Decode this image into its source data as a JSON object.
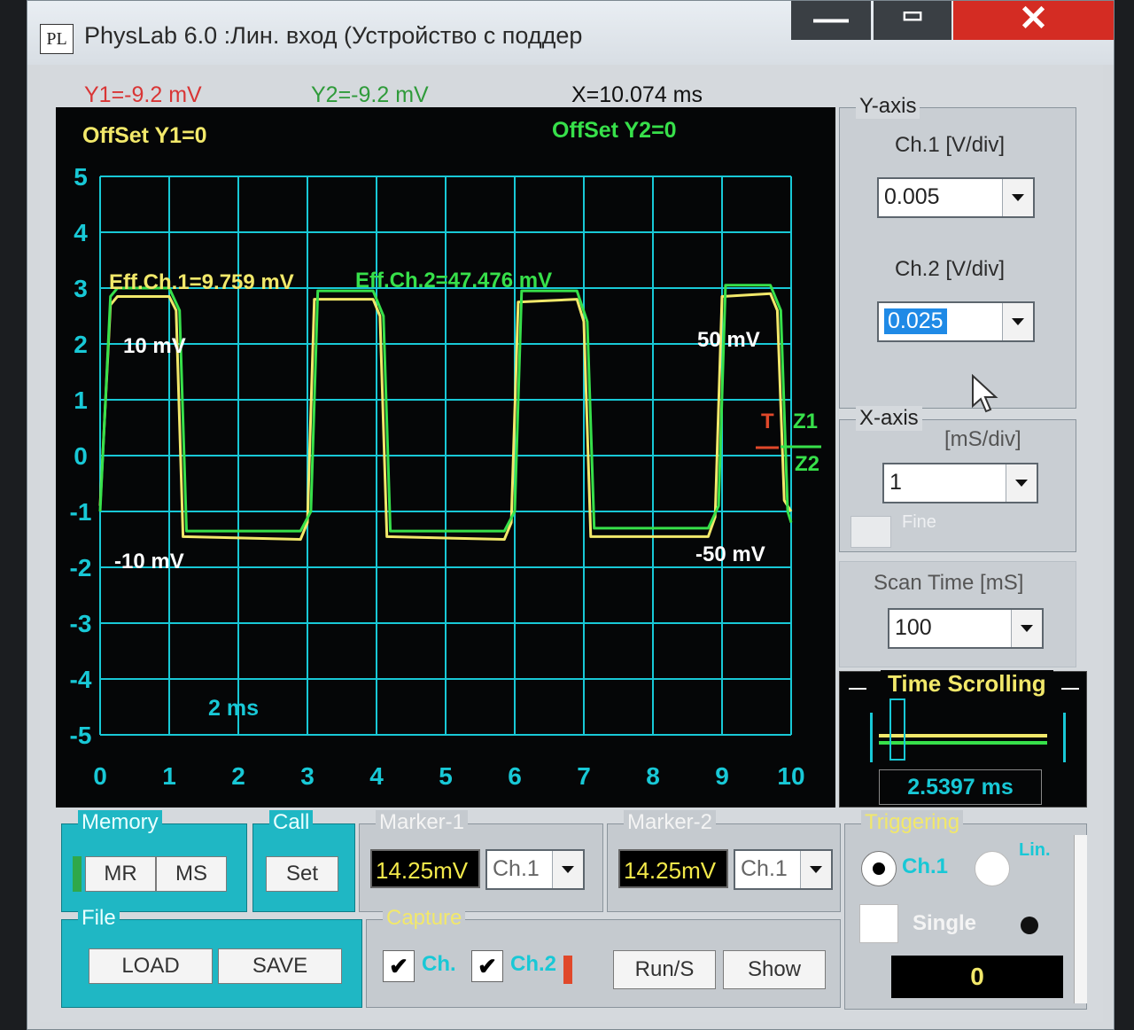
{
  "window": {
    "title": "PhysLab 6.0 :Лин. вход (Устройство с поддер",
    "logo_text": "PL",
    "minimize_glyph": "—",
    "maximize_glyph": "▭",
    "close_glyph": "✕"
  },
  "readouts": {
    "y1": "Y1=-9.2 mV",
    "y2": "Y2=-9.2 mV",
    "x": "X=10.074 ms"
  },
  "scope": {
    "offset_y1": "OffSet Y1=0",
    "offset_y2": "OffSet Y2=0",
    "eff_ch1": "Eff.Ch.1=9.759 mV",
    "eff_ch2": "Eff.Ch.2=47.476 mV",
    "ch1_top_label": "10 mV",
    "ch1_bottom_label": "-10 mV",
    "ch2_top_label": "50 mV",
    "ch2_bottom_label": "-50 mV",
    "time_label": "2 ms",
    "trigger_label": "T",
    "z1_label": "Z1",
    "z2_label": "Z2",
    "colors": {
      "grid": "#18c8d6",
      "ch1": "#f2e86a",
      "ch2": "#37e04a",
      "trigger": "#e0482a",
      "background": "#050607"
    }
  },
  "chart_data": {
    "type": "line",
    "xlim": [
      0,
      10
    ],
    "ylim": [
      -5,
      5
    ],
    "x_ticks": [
      "0",
      "1",
      "2",
      "3",
      "4",
      "5",
      "6",
      "7",
      "8",
      "9",
      "10"
    ],
    "y_ticks": [
      "5",
      "4",
      "3",
      "2",
      "1",
      "0",
      "-1",
      "-2",
      "-3",
      "-4",
      "-5"
    ],
    "grid": true,
    "series": [
      {
        "name": "Eff.Ch.1=9.759 mV",
        "x": [
          0,
          0.15,
          0.25,
          1.0,
          1.1,
          1.2,
          2.9,
          3.0,
          3.1,
          3.95,
          4.05,
          4.15,
          5.85,
          5.95,
          6.05,
          6.9,
          7.0,
          7.1,
          8.8,
          8.9,
          9.0,
          9.7,
          9.8,
          9.9,
          10.0
        ],
        "y": [
          -0.9,
          2.7,
          2.85,
          2.85,
          2.6,
          -1.45,
          -1.5,
          -1.2,
          2.8,
          2.8,
          2.5,
          -1.45,
          -1.5,
          -1.2,
          2.75,
          2.8,
          2.4,
          -1.45,
          -1.45,
          -1.1,
          2.85,
          2.9,
          2.6,
          -0.8,
          -1.0
        ]
      },
      {
        "name": "Eff.Ch.2=47.476 mV",
        "x": [
          0,
          0.15,
          0.25,
          1.0,
          1.15,
          1.25,
          2.9,
          3.05,
          3.15,
          3.95,
          4.1,
          4.2,
          5.85,
          6.0,
          6.1,
          6.9,
          7.05,
          7.15,
          8.8,
          8.95,
          9.05,
          9.7,
          9.85,
          9.95,
          10.0
        ],
        "y": [
          -1.0,
          2.85,
          3.0,
          3.0,
          2.6,
          -1.35,
          -1.35,
          -1.0,
          2.95,
          2.95,
          2.5,
          -1.35,
          -1.35,
          -1.0,
          2.95,
          2.95,
          2.4,
          -1.3,
          -1.3,
          -0.9,
          3.05,
          3.05,
          2.6,
          -1.0,
          -1.2
        ]
      }
    ]
  },
  "y_axis": {
    "legend": "Y-axis",
    "ch1_label": "Ch.1 [V/div]",
    "ch1_value": "0.005",
    "ch2_label": "Ch.2 [V/div]",
    "ch2_value": "0.025"
  },
  "x_axis": {
    "legend": "X-axis",
    "unit_label": "[mS/div]",
    "value": "1",
    "fine_label": "Fine"
  },
  "scan_time": {
    "label": "Scan Time [mS]",
    "value": "100"
  },
  "time_scrolling": {
    "legend": "Time Scrolling",
    "value": "2.5397 ms"
  },
  "memory": {
    "legend": "Memory",
    "mr_label": "MR",
    "ms_label": "MS"
  },
  "call": {
    "legend": "Call",
    "set_label": "Set"
  },
  "marker1": {
    "legend": "Marker-1",
    "value": "14.25mV",
    "channel": "Ch.1"
  },
  "marker2": {
    "legend": "Marker-2",
    "value": "14.25mV",
    "channel": "Ch.1"
  },
  "triggering": {
    "legend": "Triggering",
    "ch1_label": "Ch.1",
    "lin_label": "Lin.",
    "single_label": "Single",
    "count": "0"
  },
  "file": {
    "legend": "File",
    "load_label": "LOAD",
    "save_label": "SAVE"
  },
  "capture": {
    "legend": "Capture",
    "ch1_label": "Ch.",
    "ch2_label": "Ch.2",
    "run_label": "Run/S",
    "show_label": "Show",
    "check_glyph": "✔"
  }
}
